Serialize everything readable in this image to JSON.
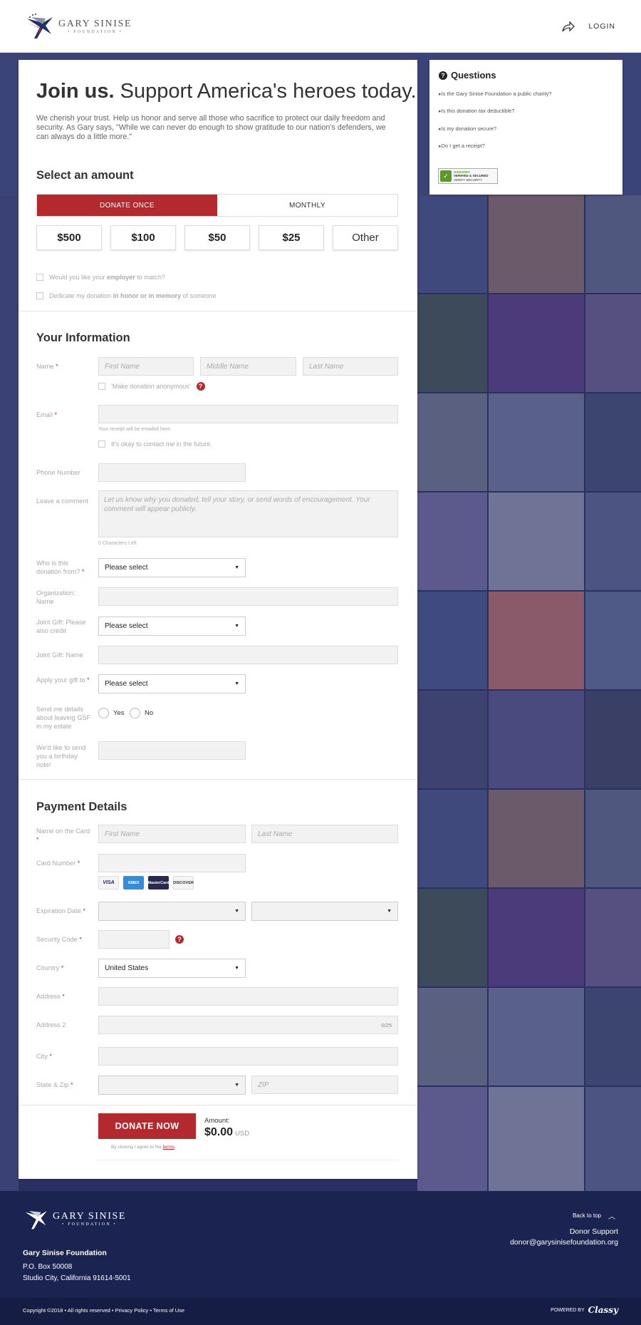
{
  "header": {
    "logo_title": "GARY SINISE",
    "logo_subtitle": "• FOUNDATION •",
    "login_label": "LOGIN"
  },
  "hero": {
    "title_bold": "Join us.",
    "title_rest": " Support America's heroes today.",
    "intro": "We cherish your trust. Help us honor and serve all those who sacrifice to protect our daily freedom and security. As Gary says, \"While we can never do enough to show gratitude to our nation's defenders, we can always do a little more.\""
  },
  "amount_section": {
    "title": "Select an amount",
    "tabs": [
      {
        "label": "DONATE ONCE",
        "active": true
      },
      {
        "label": "MONTHLY",
        "active": false
      }
    ],
    "amounts": [
      "$500",
      "$100",
      "$50",
      "$25",
      "Other"
    ],
    "employer_text_pre": "Would you like your ",
    "employer_text_bold": "employer",
    "employer_text_post": " to match?",
    "honor_text_pre": "Dedicate my donation ",
    "honor_text_bold": "in honor or in memory",
    "honor_text_post": " of someone"
  },
  "info_section": {
    "title": "Your Information",
    "name_label": "Name",
    "first_name_ph": "First Name",
    "middle_name_ph": "Middle Name",
    "last_name_ph": "Last Name",
    "anonymous_label": "'Make donation anonymous'",
    "email_label": "Email",
    "email_hint": "Your receipt will be emailed here.",
    "contact_label": "It's okay to contact me in the future.",
    "phone_label": "Phone Number",
    "comment_label": "Leave a comment",
    "comment_ph": "Let us know why you donated, tell your story, or send words of encouragement. Your comment will appear publicly.",
    "comment_counter": "0 Characters Left",
    "who_from_label": "Who is this donation from?",
    "who_from_value": "Please select",
    "org_name_label": "Organization: Name",
    "joint_credit_label": "Joint Gift: Please also credit",
    "joint_credit_value": "Please select",
    "joint_name_label": "Joint Gift: Name",
    "apply_gift_label": "Apply your gift to",
    "apply_gift_value": "Please select",
    "estate_label": "Send me details about leaving GSF in my estate",
    "estate_yes": "Yes",
    "estate_no": "No",
    "birthday_label": "We'd like to send you a birthday note!"
  },
  "payment_section": {
    "title": "Payment Details",
    "card_name_label": "Name on the Card",
    "card_first_ph": "First Name",
    "card_last_ph": "Last Name",
    "card_number_label": "Card Number",
    "card_brands": [
      "VISA",
      "AMEX",
      "MasterCard",
      "DISCOVER"
    ],
    "expiration_label": "Expiration Date",
    "security_label": "Security Code",
    "country_label": "Country",
    "country_value": "United States",
    "address_label": "Address",
    "address2_label": "Address 2",
    "address2_counter": "0/25",
    "city_label": "City",
    "statezip_label": "State & Zip",
    "zip_ph": "ZIP"
  },
  "donate": {
    "button_label": "DONATE NOW",
    "amount_label": "Amount:",
    "amount_value": "$0.00",
    "currency": "USD",
    "terms_pre": "By clicking I agree to the ",
    "terms_link": "terms"
  },
  "questions": {
    "title": "Questions",
    "items": [
      "Is the Gary Sinise Foundation a public charity?",
      "Is this donation tax deductible?",
      "Is my donation secure?",
      "Do I get a receipt?"
    ],
    "badge_top": "GODADDY",
    "badge_main": "VERIFIED & SECURED",
    "badge_sub": "VERIFY SECURITY"
  },
  "footer": {
    "logo_title": "GARY SINISE",
    "logo_subtitle": "• FOUNDATION •",
    "org_name": "Gary Sinise Foundation",
    "address_line1": "P.O. Box 50008",
    "address_line2": "Studio City, California 91614-5001",
    "back_to_top": "Back to top",
    "support_label": "Donor Support",
    "support_email": "donor@garysinisefoundation.org",
    "copyright": "Copyright ©2018 • All rights reserved • Privacy Policy • Terms of Use",
    "powered_by": "POWERED BY",
    "powered_brand": "Classy"
  },
  "colors": {
    "accent": "#b3292d",
    "footer_bg": "#1b2350",
    "background_overlay": "#2a3160"
  }
}
